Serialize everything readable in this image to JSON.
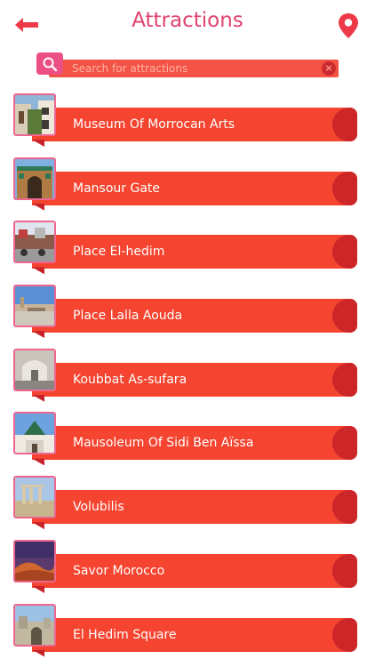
{
  "header": {
    "title": "Attractions",
    "back_icon": "back-arrow-icon",
    "map_icon": "map-pin-icon",
    "accent_color": "#e0426e"
  },
  "search": {
    "placeholder": "Search for attractions",
    "value": "",
    "search_icon": "search-icon",
    "clear_icon": "clear-icon",
    "bar_color": "#f35344"
  },
  "attractions": [
    {
      "name": "Museum Of Morrocan Arts",
      "thumb": "museum-photo"
    },
    {
      "name": "Mansour Gate",
      "thumb": "gate-photo"
    },
    {
      "name": "Place El-hedim",
      "thumb": "square-photo"
    },
    {
      "name": "Place Lalla Aouda",
      "thumb": "plaza-photo"
    },
    {
      "name": "Koubbat As-sufara",
      "thumb": "interior-photo"
    },
    {
      "name": "Mausoleum Of Sidi Ben Aïssa",
      "thumb": "mausoleum-photo"
    },
    {
      "name": "Volubilis",
      "thumb": "ruins-photo"
    },
    {
      "name": "Savor Morocco",
      "thumb": "desert-photo"
    },
    {
      "name": "El Hedim Square",
      "thumb": "town-photo"
    }
  ],
  "colors": {
    "row_bar": "#f5442f",
    "row_tab": "#cc2628",
    "thumb_border": "#ee6690",
    "search_button": "#ec4f86"
  }
}
